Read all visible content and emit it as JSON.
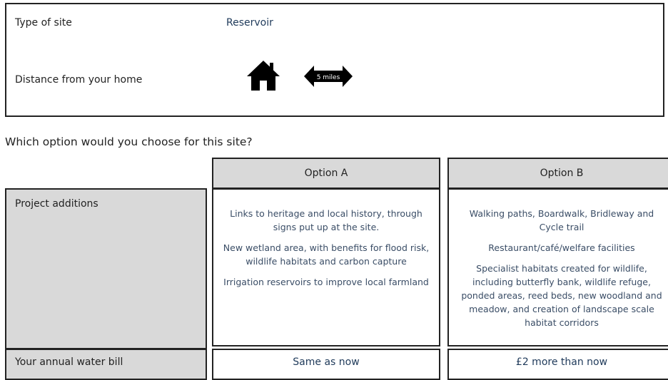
{
  "site": {
    "type_label": "Type of site",
    "type_value": "Reservoir",
    "distance_label": "Distance from your home",
    "distance_value": "5 miles",
    "icons": [
      "home-icon",
      "double-arrow-icon"
    ]
  },
  "question": "Which option would you choose for this site?",
  "table": {
    "headers": [
      "Option A",
      "Option B"
    ],
    "rows": {
      "project_additions": {
        "label": "Project additions",
        "option_a": [
          "Links to heritage and local history, through signs put up at the site.",
          "New wetland area, with benefits for flood risk, wildlife habitats and carbon capture",
          "Irrigation reservoirs to improve local farmland"
        ],
        "option_b": [
          "Walking paths, Boardwalk, Bridleway and Cycle trail",
          "Restaurant/café/welfare facilities",
          "Specialist habitats created for wildlife, including butterfly bank, wildlife refuge, ponded areas, reed beds, new woodland and meadow, and creation of landscape scale habitat corridors"
        ]
      },
      "water_bill": {
        "label": "Your annual water bill",
        "option_a": "Same as now",
        "option_b": "£2 more than now"
      }
    }
  },
  "colors": {
    "label_grey": "#d9d9d9",
    "value_text": "#1f3a5a",
    "border": "#222222"
  }
}
